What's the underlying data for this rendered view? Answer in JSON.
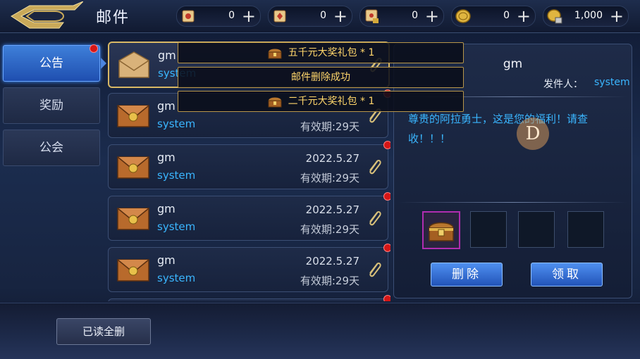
{
  "header": {
    "title": "邮件",
    "resources": [
      {
        "icon": "scroll-ticket-icon",
        "value": "0"
      },
      {
        "icon": "red-scroll-icon",
        "value": "0"
      },
      {
        "icon": "locked-scroll-icon",
        "value": "0"
      },
      {
        "icon": "gold-coin-icon",
        "value": "0"
      },
      {
        "icon": "locked-gold-icon",
        "value": "1,000"
      }
    ],
    "plus": "+"
  },
  "tabs": [
    {
      "label": "公告",
      "active": true,
      "has_new": true
    },
    {
      "label": "奖励",
      "active": false,
      "has_new": false
    },
    {
      "label": "公会",
      "active": false,
      "has_new": false
    }
  ],
  "mails": [
    {
      "from": "gm",
      "sender": "system",
      "date": "",
      "expiry": "",
      "opened": true
    },
    {
      "from": "gm",
      "sender": "system",
      "date": "",
      "expiry": "有效期:29天"
    },
    {
      "from": "gm",
      "sender": "system",
      "date": "2022.5.27",
      "expiry": "有效期:29天"
    },
    {
      "from": "gm",
      "sender": "system",
      "date": "2022.5.27",
      "expiry": "有效期:29天"
    },
    {
      "from": "gm",
      "sender": "system",
      "date": "2022.5.27",
      "expiry": "有效期:29天"
    }
  ],
  "detail": {
    "title": "gm",
    "sender_label": "发件人：",
    "sender": "system",
    "body": "尊贵的阿拉勇士，这是您的福利！请查收！！！",
    "watermark": "D",
    "delete_label": "删除",
    "claim_label": "领取"
  },
  "footer": {
    "read_all_delete": "已读全删"
  },
  "toasts": [
    {
      "text": "五千元大奖礼包 * 1",
      "icon": "treasure-chest-icon"
    },
    {
      "text": "邮件删除成功"
    },
    {
      "text": "二千元大奖礼包 * 1",
      "icon": "treasure-chest-icon"
    }
  ],
  "colors": {
    "accent_blue": "#3ab6ff",
    "toast_gold": "#ffd66b",
    "badge_red": "#d51616"
  }
}
